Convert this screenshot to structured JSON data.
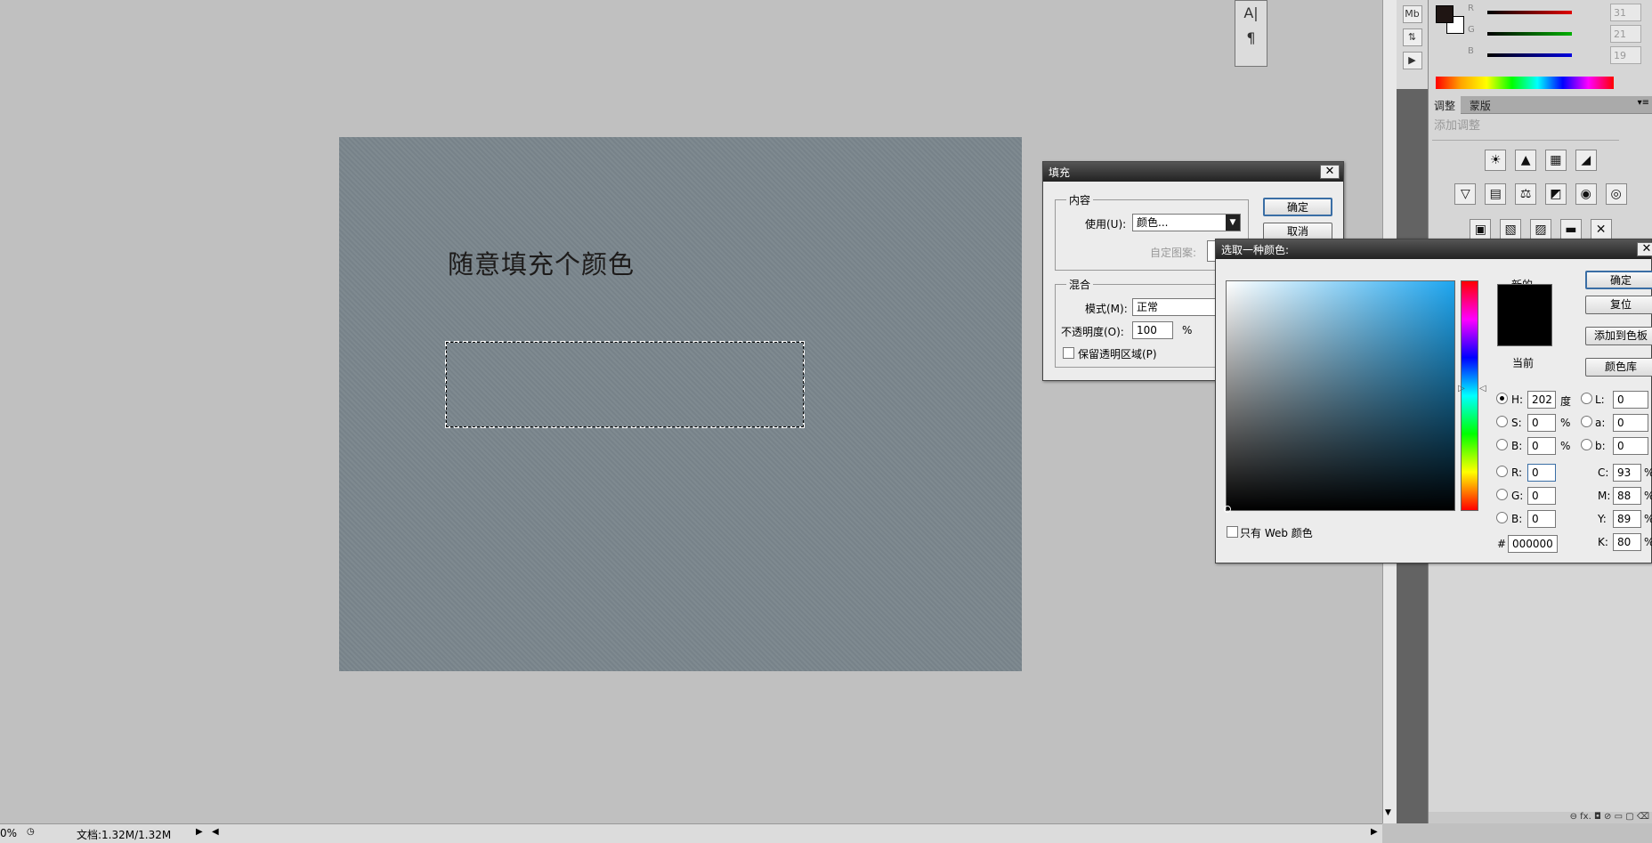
{
  "canvas": {
    "text": "随意填充个颜色"
  },
  "mini_toolbar": {
    "icons": [
      "character-icon",
      "paragraph-icon"
    ],
    "glyphs": [
      "A|",
      "¶"
    ]
  },
  "right_panel": {
    "sliders": [
      {
        "label": "R",
        "value": "31",
        "color": "#e00000"
      },
      {
        "label": "G",
        "value": "21",
        "color": "#00b000"
      },
      {
        "label": "B",
        "value": "19",
        "color": "#0000e0"
      }
    ],
    "tabs": [
      "调整",
      "蒙版"
    ],
    "add_adjustment": "添加调整",
    "panel_menu_glyph": "▾≡",
    "adjust_icons_row1": [
      "☀",
      "▲",
      "▦",
      "◢"
    ],
    "adjust_icons_row2": [
      "▽",
      "▤",
      "⚖",
      "◩",
      "◉",
      "◎"
    ],
    "adjust_icons_row3": [
      "▣",
      "▧",
      "▨",
      "▬",
      "✕"
    ],
    "footer": "⊖ fx. ◘ ⊘ ▭ ▢ ⌫"
  },
  "statusbar": {
    "zoom": "0%",
    "doc": "文档:1.32M/1.32M"
  },
  "fill_dialog": {
    "title": "填充",
    "close": "✕",
    "ok": "确定",
    "cancel": "取消",
    "content_group": "内容",
    "use_label": "使用(U):",
    "use_value": "颜色...",
    "custom_pattern_label": "自定图案:",
    "blend_group": "混合",
    "mode_label": "模式(M):",
    "mode_value": "正常",
    "opacity_label": "不透明度(O):",
    "opacity_value": "100",
    "opacity_unit": "%",
    "preserve_label": "保留透明区域(P)"
  },
  "color_picker": {
    "title": "选取一种颜色:",
    "close": "✕",
    "new_label": "新的",
    "current_label": "当前",
    "ok": "确定",
    "reset": "复位",
    "add_swatch": "添加到色板",
    "color_libraries": "颜色库",
    "web_only": "只有 Web 颜色",
    "hsb": [
      {
        "label": "H:",
        "value": "202",
        "unit": "度",
        "selected": true
      },
      {
        "label": "S:",
        "value": "0",
        "unit": "%",
        "selected": false
      },
      {
        "label": "B:",
        "value": "0",
        "unit": "%",
        "selected": false
      }
    ],
    "rgb": [
      {
        "label": "R:",
        "value": "0"
      },
      {
        "label": "G:",
        "value": "0"
      },
      {
        "label": "B:",
        "value": "0"
      }
    ],
    "lab": [
      {
        "label": "L:",
        "value": "0"
      },
      {
        "label": "a:",
        "value": "0"
      },
      {
        "label": "b:",
        "value": "0"
      }
    ],
    "cmyk": [
      {
        "label": "C:",
        "value": "93",
        "unit": "%"
      },
      {
        "label": "M:",
        "value": "88",
        "unit": "%"
      },
      {
        "label": "Y:",
        "value": "89",
        "unit": "%"
      },
      {
        "label": "K:",
        "value": "80",
        "unit": "%"
      }
    ],
    "hex_label": "#",
    "hex_value": "000000"
  }
}
